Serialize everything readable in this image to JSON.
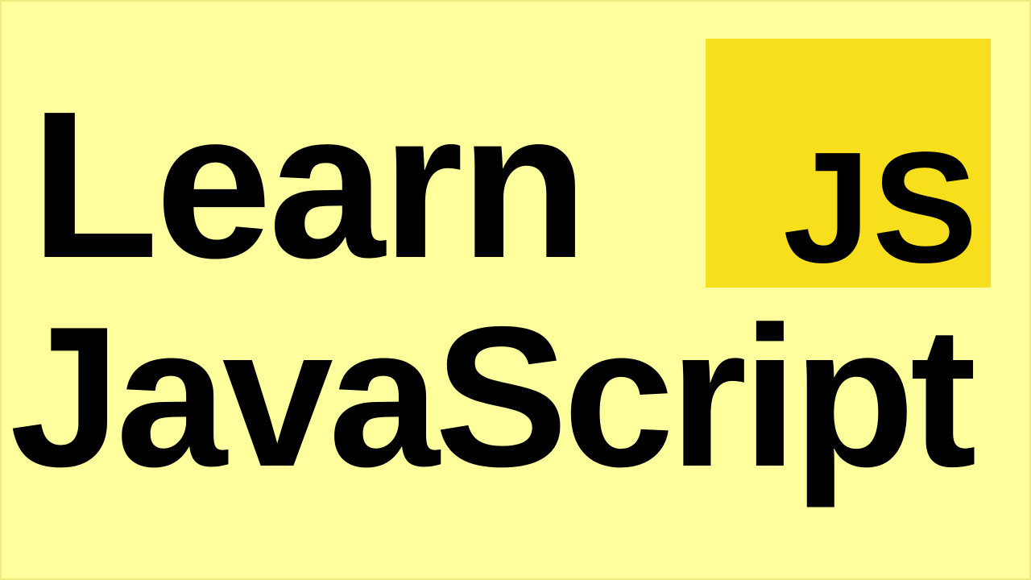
{
  "title": {
    "line_one": "Learn",
    "line_two": "JavaScript"
  },
  "logo": {
    "text": "JS",
    "icon": "javascript-logo-icon"
  },
  "colors": {
    "background": "#ffff9e",
    "border": "#ecec80",
    "logo_background": "#f7df1e",
    "text": "#000000"
  }
}
